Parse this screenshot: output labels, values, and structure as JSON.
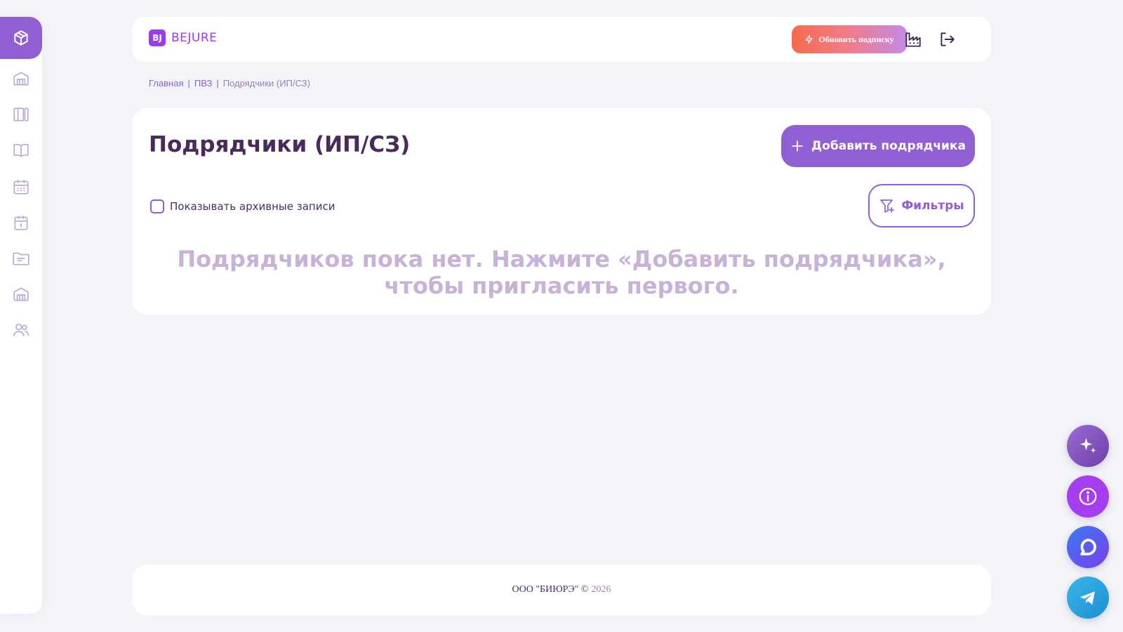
{
  "header": {
    "logo_mark": "BJ",
    "logo_text": "BEJURE",
    "upgrade_label": "Обновить подписку",
    "icons": [
      "lightning-icon",
      "factory-icon",
      "logout-icon"
    ]
  },
  "sidebar": {
    "items": [
      {
        "name": "box-icon",
        "active": true
      },
      {
        "name": "warehouse-icon"
      },
      {
        "name": "columns-icon"
      },
      {
        "name": "book-icon"
      },
      {
        "name": "calendar-grid-icon"
      },
      {
        "name": "calendar-icon"
      },
      {
        "name": "folder-icon"
      },
      {
        "name": "warehouse-icon"
      },
      {
        "name": "users-icon"
      }
    ]
  },
  "breadcrumb": {
    "items": [
      "Главная",
      "ПВЗ",
      "Подрядчики (ИП/СЗ)"
    ],
    "separator": "|"
  },
  "main": {
    "title": "Подрядчики (ИП/СЗ)",
    "add_button": "Добавить подрядчика",
    "show_archived_label": "Показывать архивные записи",
    "filters_button": "Фильтры",
    "empty_message": "Подрядчиков пока нет. Нажмите «Добавить подрядчика», чтобы пригласить первого."
  },
  "footer": {
    "company": "ООО \"БИЮРЭ\" ©",
    "year": "2026"
  },
  "fabs": [
    "sparkle-icon",
    "info-icon",
    "chat-icon",
    "telegram-icon"
  ],
  "colors": {
    "accent": "#8f5fd3",
    "title": "#4a2a5c",
    "empty_text": "#c9b2d8",
    "background": "#f2f4f8",
    "upgrade_gradient_start": "#f56b4f",
    "upgrade_gradient_end": "#c48ae8"
  }
}
